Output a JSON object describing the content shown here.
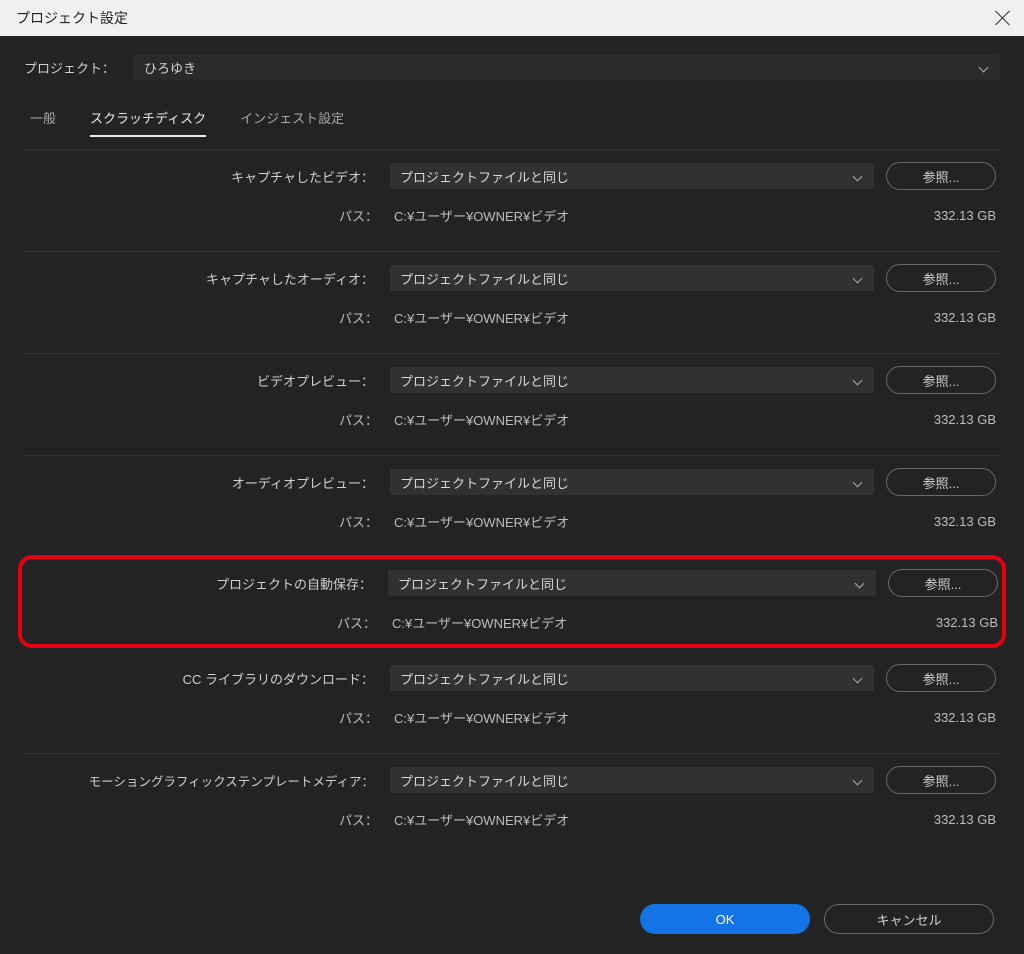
{
  "title": "プロジェクト設定",
  "project": {
    "label": "プロジェクト：",
    "value": "ひろゆき"
  },
  "tabs": {
    "general": "一般",
    "scratch": "スクラッチディスク",
    "ingest": "インジェスト設定"
  },
  "browse_label": "参照...",
  "path_label": "パス：",
  "dropdown_value": "プロジェクトファイルと同じ",
  "path_value": "C:¥ユーザー¥OWNER¥ビデオ",
  "size_value": "332.13 GB",
  "sections": {
    "captured_video": {
      "label": "キャプチャしたビデオ："
    },
    "captured_audio": {
      "label": "キャプチャしたオーディオ："
    },
    "video_preview": {
      "label": "ビデオプレビュー："
    },
    "audio_preview": {
      "label": "オーディオプレビュー："
    },
    "autosave": {
      "label": "プロジェクトの自動保存："
    },
    "cc_libraries": {
      "label": "CC ライブラリのダウンロード："
    },
    "motion_graphics": {
      "label": "モーショングラフィックステンプレートメディア："
    }
  },
  "footer": {
    "ok": "OK",
    "cancel": "キャンセル"
  }
}
